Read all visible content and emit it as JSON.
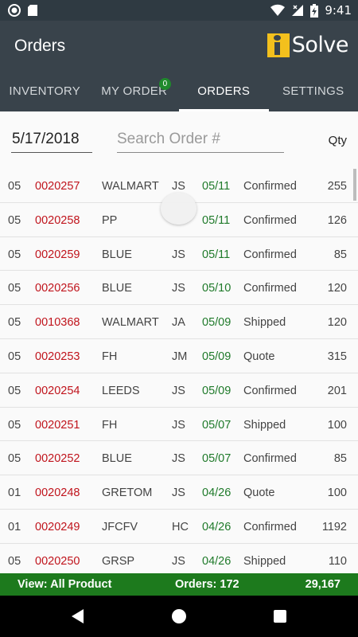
{
  "status_bar": {
    "time": "9:41"
  },
  "app": {
    "title": "Orders",
    "logo_text": "Solve",
    "logo_mark": "i"
  },
  "tabs": [
    {
      "label": "INVENTORY"
    },
    {
      "label": "MY ORDER",
      "badge": "0"
    },
    {
      "label": "ORDERS"
    },
    {
      "label": "SETTINGS"
    }
  ],
  "filter": {
    "date": "5/17/2018",
    "search_placeholder": "Search Order #",
    "qty_header": "Qty"
  },
  "orders": [
    {
      "wh": "05",
      "order": "0020257",
      "customer": "WALMART",
      "rep": "JS",
      "date": "05/11",
      "status": "Confirmed",
      "qty": "255"
    },
    {
      "wh": "05",
      "order": "0020258",
      "customer": "PP",
      "rep": "",
      "date": "05/11",
      "status": "Confirmed",
      "qty": "126"
    },
    {
      "wh": "05",
      "order": "0020259",
      "customer": "BLUE",
      "rep": "JS",
      "date": "05/11",
      "status": "Confirmed",
      "qty": "85"
    },
    {
      "wh": "05",
      "order": "0020256",
      "customer": "BLUE",
      "rep": "JS",
      "date": "05/10",
      "status": "Confirmed",
      "qty": "120"
    },
    {
      "wh": "05",
      "order": "0010368",
      "customer": "WALMART",
      "rep": "JA",
      "date": "05/09",
      "status": "Shipped",
      "qty": "120"
    },
    {
      "wh": "05",
      "order": "0020253",
      "customer": "FH",
      "rep": "JM",
      "date": "05/09",
      "status": "Quote",
      "qty": "315"
    },
    {
      "wh": "05",
      "order": "0020254",
      "customer": "LEEDS",
      "rep": "JS",
      "date": "05/09",
      "status": "Confirmed",
      "qty": "201"
    },
    {
      "wh": "05",
      "order": "0020251",
      "customer": "FH",
      "rep": "JS",
      "date": "05/07",
      "status": "Shipped",
      "qty": "100"
    },
    {
      "wh": "05",
      "order": "0020252",
      "customer": "BLUE",
      "rep": "JS",
      "date": "05/07",
      "status": "Confirmed",
      "qty": "85"
    },
    {
      "wh": "01",
      "order": "0020248",
      "customer": "GRETOM",
      "rep": "JS",
      "date": "04/26",
      "status": "Quote",
      "qty": "100"
    },
    {
      "wh": "01",
      "order": "0020249",
      "customer": "JFCFV",
      "rep": "HC",
      "date": "04/26",
      "status": "Confirmed",
      "qty": "1192"
    },
    {
      "wh": "05",
      "order": "0020250",
      "customer": "GRSP",
      "rep": "JS",
      "date": "04/26",
      "status": "Shipped",
      "qty": "110"
    }
  ],
  "footer": {
    "view": "View: All Product",
    "orders": "Orders: 172",
    "total": "29,167"
  },
  "colors": {
    "appbar": "#39434b",
    "order_number": "#c0141c",
    "date": "#1f7a2a",
    "footer": "#1d7a1d",
    "logo": "#f3c01d"
  }
}
